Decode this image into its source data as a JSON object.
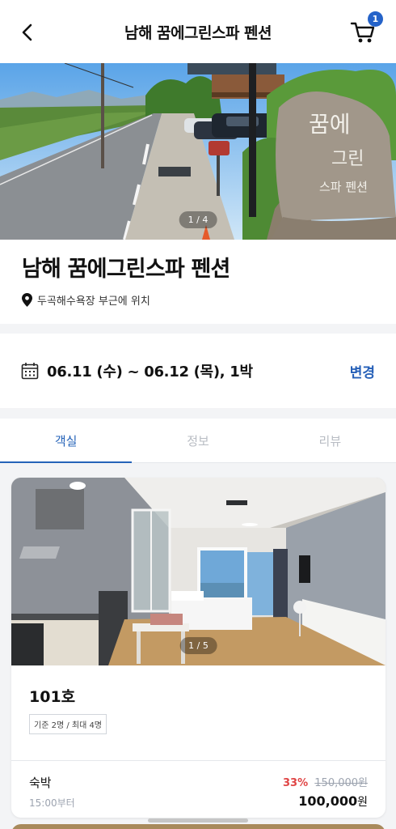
{
  "header": {
    "title": "남해 꿈에그린스파 펜션",
    "cart_count": "1"
  },
  "hero": {
    "counter": "1 / 4",
    "sign_lines": [
      "꿈에",
      "그린",
      "스파 펜션"
    ]
  },
  "property": {
    "name": "남해 꿈에그린스파 펜션",
    "location": "두곡해수욕장 부근에 위치"
  },
  "booking": {
    "dates": "06.11 (수) ~ 06.12 (목), 1박",
    "change_label": "변경"
  },
  "tabs": [
    {
      "label": "객실",
      "active": true
    },
    {
      "label": "정보",
      "active": false
    },
    {
      "label": "리뷰",
      "active": false
    }
  ],
  "rooms": [
    {
      "photo_counter": "1 / 5",
      "name": "101호",
      "capacity": "기준 2명 / 최대 4명",
      "rate_type": "숙박",
      "checkin": "15:00부터",
      "discount": "33%",
      "original_price": "150,000원",
      "price": "100,000",
      "currency": "원"
    }
  ],
  "colors": {
    "accent": "#2563b8",
    "discount": "#e04545",
    "badge": "#2563c9"
  }
}
